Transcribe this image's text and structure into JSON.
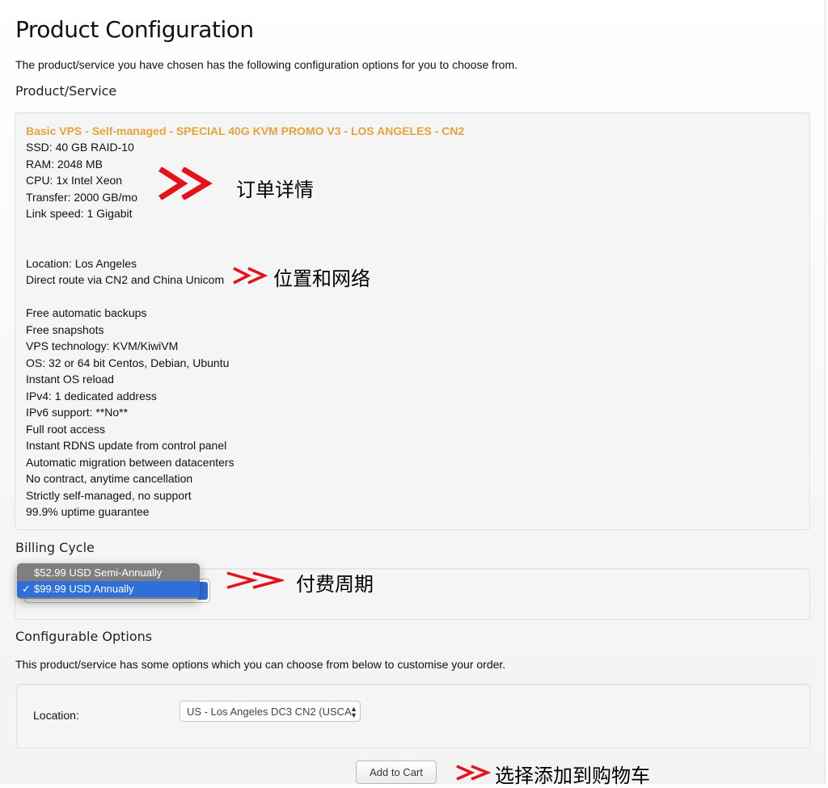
{
  "page": {
    "title": "Product Configuration",
    "intro": "The product/service you have chosen has the following configuration options for you to choose from."
  },
  "product_section": {
    "heading": "Product/Service",
    "product_name": "Basic VPS - Self-managed - SPECIAL 40G KVM PROMO V3 - LOS ANGELES - CN2",
    "specs": [
      "SSD: 40 GB RAID-10",
      "RAM: 2048 MB",
      "CPU: 1x Intel Xeon",
      "Transfer: 2000 GB/mo",
      "Link speed: 1 Gigabit"
    ],
    "location_lines": [
      "Location: Los Angeles",
      "Direct route via CN2 and China Unicom"
    ],
    "features": [
      "Free automatic backups",
      "Free snapshots",
      "VPS technology: KVM/KiwiVM",
      "OS: 32 or 64 bit Centos, Debian, Ubuntu",
      "Instant OS reload",
      "IPv4: 1 dedicated address",
      "IPv6 support: **No**",
      "Full root access",
      "Instant RDNS update from control panel",
      "Automatic migration between datacenters",
      "No contract, anytime cancellation",
      "Strictly self-managed, no support",
      "99.9% uptime guarantee"
    ]
  },
  "billing": {
    "heading": "Billing Cycle",
    "options": [
      {
        "label": "$52.99 USD Semi-Annually",
        "selected": false
      },
      {
        "label": "$99.99 USD Annually",
        "selected": true
      }
    ],
    "check_mark": "✓"
  },
  "configurable": {
    "heading": "Configurable Options",
    "description": "This product/service has some options which you can choose from below to customise your order.",
    "location_label": "Location:",
    "location_value": "US - Los Angeles DC3 CN2 (USCA"
  },
  "actions": {
    "add_to_cart": "Add to Cart"
  },
  "annotations": {
    "order_details": "订单详情",
    "location_network": "位置和网络",
    "billing_cycle": "付费周期",
    "add_to_cart": "选择添加到购物车"
  },
  "colors": {
    "product_name": "#e8a23a",
    "annotation_arrow": "#e3121b",
    "selected_option": "#2e6fd9"
  },
  "icons": {
    "arrow": "red-double-chevron-icon",
    "select_arrows": "updown-arrows-icon"
  }
}
